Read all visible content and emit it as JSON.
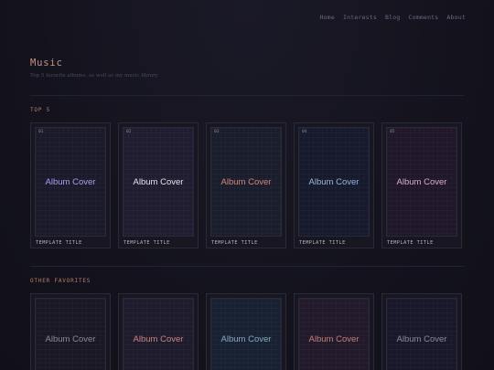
{
  "nav": {
    "items": [
      "Home",
      "Interests",
      "Blog",
      "Comments",
      "About"
    ]
  },
  "header": {
    "title": "Music",
    "subtitle": "Top 5 favorite albums, as well as my music library"
  },
  "sections": {
    "top5": {
      "label": "TOP 5",
      "albums": [
        {
          "num": "01",
          "cover_text": "Album Cover",
          "title": "TEMPLATE TITLE",
          "text_color": "#a79ef0",
          "bg": "#1b1a2b"
        },
        {
          "num": "02",
          "cover_text": "Album Cover",
          "title": "TEMPLATE TITLE",
          "text_color": "#e6e3ee",
          "bg": "#1f1d2f"
        },
        {
          "num": "03",
          "cover_text": "Album Cover",
          "title": "TEMPLATE TITLE",
          "text_color": "#d2887e",
          "bg": "#1a1d2c"
        },
        {
          "num": "04",
          "cover_text": "Album Cover",
          "title": "TEMPLATE TITLE",
          "text_color": "#9cb4dc",
          "bg": "#151a2c"
        },
        {
          "num": "05",
          "cover_text": "Album Cover",
          "title": "TEMPLATE TITLE",
          "text_color": "#d4aec2",
          "bg": "#21172a"
        }
      ]
    },
    "other": {
      "label": "OTHER FAVORITES",
      "albums": [
        {
          "cover_text": "Album Cover",
          "text_color": "#8a8896",
          "bg": "#191824"
        },
        {
          "cover_text": "Album Cover",
          "text_color": "#c98480",
          "bg": "#1d1b2c"
        },
        {
          "cover_text": "Album Cover",
          "text_color": "#8aa8c4",
          "bg": "#172131"
        },
        {
          "cover_text": "Album Cover",
          "text_color": "#c57e78",
          "bg": "#221a2b"
        },
        {
          "cover_text": "Album Cover",
          "text_color": "#8a8896",
          "bg": "#19182a"
        }
      ]
    }
  }
}
